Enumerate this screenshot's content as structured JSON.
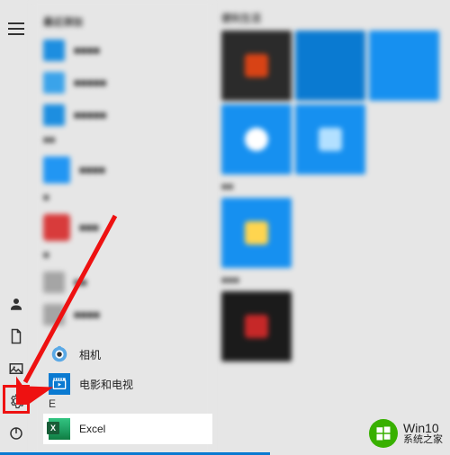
{
  "rail": {
    "menu": "menu",
    "user": "user",
    "documents": "documents",
    "pictures": "pictures",
    "settings": "settings",
    "power": "power"
  },
  "apps": {
    "section_letter_e": "E",
    "camera_label": "相机",
    "movies_tv_label": "电影和电视",
    "excel_label": "Excel"
  },
  "blurred_apps": {
    "header1": "最近添加",
    "items1": [
      {
        "label": "■■■■",
        "color": "#1d8ee0"
      },
      {
        "label": "■■■■■",
        "color": "#3aa3ea"
      },
      {
        "label": "■■■■■",
        "color": "#1d8ee0"
      }
    ],
    "header2": "■■",
    "items2": [
      {
        "label": "■■■■",
        "color": "#2196f3"
      }
    ],
    "header3": "■",
    "items3": [
      {
        "label": "■■■",
        "color": "#d83b3b"
      }
    ],
    "header4": "■",
    "items4": [
      {
        "label": "■■",
        "color": "#a5a5a5"
      },
      {
        "label": "■■■■",
        "color": "#a5a5a5"
      }
    ]
  },
  "tiles": {
    "group1_label": "便利生活",
    "group1": [
      [
        {
          "bg": "#2b2b2b",
          "inner": "#d84315",
          "size": "m"
        },
        {
          "bg": "#0a7ad1",
          "inner": "#ff7043",
          "size": "m"
        },
        {
          "bg": "#1690f0",
          "inner": "#1690f0",
          "size": "m"
        }
      ],
      [
        {
          "bg": "#1690f0",
          "inner": "#fff",
          "size": "m"
        },
        {
          "bg": "#1690f0",
          "inner": "#b3e0ff",
          "size": "m"
        }
      ]
    ],
    "group2_label": "■■",
    "group2": [
      [
        {
          "bg": "#1690f0",
          "inner": "#ffd54f",
          "size": "m"
        }
      ]
    ],
    "group3_label": "■■■",
    "group3": [
      [
        {
          "bg": "#1b1b1b",
          "inner": "#c62828",
          "size": "m"
        }
      ]
    ]
  },
  "watermark": {
    "line1": "Win10",
    "line2": "系统之家"
  }
}
